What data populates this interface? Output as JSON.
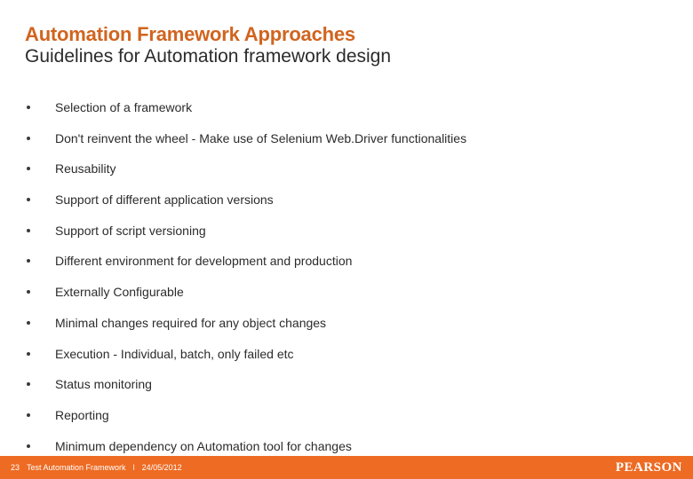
{
  "heading": {
    "title": "Automation Framework Approaches",
    "subtitle": "Guidelines for Automation framework design"
  },
  "bullets": [
    "Selection of a framework",
    "Don't reinvent the wheel - Make use of Selenium Web.Driver functionalities",
    "Reusability",
    "Support of different application versions",
    "Support of script versioning",
    "Different environment for development and production",
    "Externally Configurable",
    "Minimal changes required for any object changes",
    "Execution - Individual, batch, only failed etc",
    "Status monitoring",
    "Reporting",
    "Minimum dependency on Automation tool for changes"
  ],
  "footer": {
    "page": "23",
    "doc_title": "Test Automation Framework",
    "sep": "l",
    "date": "24/05/2012",
    "brand": "PEARSON"
  }
}
